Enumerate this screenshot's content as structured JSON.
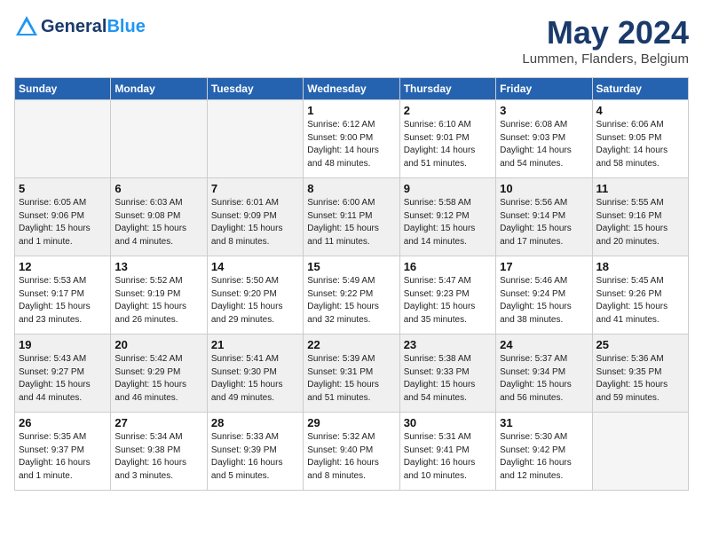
{
  "header": {
    "logo_general": "General",
    "logo_blue": "Blue",
    "month_title": "May 2024",
    "location": "Lummen, Flanders, Belgium"
  },
  "days_of_week": [
    "Sunday",
    "Monday",
    "Tuesday",
    "Wednesday",
    "Thursday",
    "Friday",
    "Saturday"
  ],
  "weeks": [
    [
      {
        "day": "",
        "info": "",
        "empty": true
      },
      {
        "day": "",
        "info": "",
        "empty": true
      },
      {
        "day": "",
        "info": "",
        "empty": true
      },
      {
        "day": "1",
        "info": "Sunrise: 6:12 AM\nSunset: 9:00 PM\nDaylight: 14 hours\nand 48 minutes."
      },
      {
        "day": "2",
        "info": "Sunrise: 6:10 AM\nSunset: 9:01 PM\nDaylight: 14 hours\nand 51 minutes."
      },
      {
        "day": "3",
        "info": "Sunrise: 6:08 AM\nSunset: 9:03 PM\nDaylight: 14 hours\nand 54 minutes."
      },
      {
        "day": "4",
        "info": "Sunrise: 6:06 AM\nSunset: 9:05 PM\nDaylight: 14 hours\nand 58 minutes."
      }
    ],
    [
      {
        "day": "5",
        "info": "Sunrise: 6:05 AM\nSunset: 9:06 PM\nDaylight: 15 hours\nand 1 minute.",
        "shaded": true
      },
      {
        "day": "6",
        "info": "Sunrise: 6:03 AM\nSunset: 9:08 PM\nDaylight: 15 hours\nand 4 minutes.",
        "shaded": true
      },
      {
        "day": "7",
        "info": "Sunrise: 6:01 AM\nSunset: 9:09 PM\nDaylight: 15 hours\nand 8 minutes.",
        "shaded": true
      },
      {
        "day": "8",
        "info": "Sunrise: 6:00 AM\nSunset: 9:11 PM\nDaylight: 15 hours\nand 11 minutes.",
        "shaded": true
      },
      {
        "day": "9",
        "info": "Sunrise: 5:58 AM\nSunset: 9:12 PM\nDaylight: 15 hours\nand 14 minutes.",
        "shaded": true
      },
      {
        "day": "10",
        "info": "Sunrise: 5:56 AM\nSunset: 9:14 PM\nDaylight: 15 hours\nand 17 minutes.",
        "shaded": true
      },
      {
        "day": "11",
        "info": "Sunrise: 5:55 AM\nSunset: 9:16 PM\nDaylight: 15 hours\nand 20 minutes.",
        "shaded": true
      }
    ],
    [
      {
        "day": "12",
        "info": "Sunrise: 5:53 AM\nSunset: 9:17 PM\nDaylight: 15 hours\nand 23 minutes."
      },
      {
        "day": "13",
        "info": "Sunrise: 5:52 AM\nSunset: 9:19 PM\nDaylight: 15 hours\nand 26 minutes."
      },
      {
        "day": "14",
        "info": "Sunrise: 5:50 AM\nSunset: 9:20 PM\nDaylight: 15 hours\nand 29 minutes."
      },
      {
        "day": "15",
        "info": "Sunrise: 5:49 AM\nSunset: 9:22 PM\nDaylight: 15 hours\nand 32 minutes."
      },
      {
        "day": "16",
        "info": "Sunrise: 5:47 AM\nSunset: 9:23 PM\nDaylight: 15 hours\nand 35 minutes."
      },
      {
        "day": "17",
        "info": "Sunrise: 5:46 AM\nSunset: 9:24 PM\nDaylight: 15 hours\nand 38 minutes."
      },
      {
        "day": "18",
        "info": "Sunrise: 5:45 AM\nSunset: 9:26 PM\nDaylight: 15 hours\nand 41 minutes."
      }
    ],
    [
      {
        "day": "19",
        "info": "Sunrise: 5:43 AM\nSunset: 9:27 PM\nDaylight: 15 hours\nand 44 minutes.",
        "shaded": true
      },
      {
        "day": "20",
        "info": "Sunrise: 5:42 AM\nSunset: 9:29 PM\nDaylight: 15 hours\nand 46 minutes.",
        "shaded": true
      },
      {
        "day": "21",
        "info": "Sunrise: 5:41 AM\nSunset: 9:30 PM\nDaylight: 15 hours\nand 49 minutes.",
        "shaded": true
      },
      {
        "day": "22",
        "info": "Sunrise: 5:39 AM\nSunset: 9:31 PM\nDaylight: 15 hours\nand 51 minutes.",
        "shaded": true
      },
      {
        "day": "23",
        "info": "Sunrise: 5:38 AM\nSunset: 9:33 PM\nDaylight: 15 hours\nand 54 minutes.",
        "shaded": true
      },
      {
        "day": "24",
        "info": "Sunrise: 5:37 AM\nSunset: 9:34 PM\nDaylight: 15 hours\nand 56 minutes.",
        "shaded": true
      },
      {
        "day": "25",
        "info": "Sunrise: 5:36 AM\nSunset: 9:35 PM\nDaylight: 15 hours\nand 59 minutes.",
        "shaded": true
      }
    ],
    [
      {
        "day": "26",
        "info": "Sunrise: 5:35 AM\nSunset: 9:37 PM\nDaylight: 16 hours\nand 1 minute."
      },
      {
        "day": "27",
        "info": "Sunrise: 5:34 AM\nSunset: 9:38 PM\nDaylight: 16 hours\nand 3 minutes."
      },
      {
        "day": "28",
        "info": "Sunrise: 5:33 AM\nSunset: 9:39 PM\nDaylight: 16 hours\nand 5 minutes."
      },
      {
        "day": "29",
        "info": "Sunrise: 5:32 AM\nSunset: 9:40 PM\nDaylight: 16 hours\nand 8 minutes."
      },
      {
        "day": "30",
        "info": "Sunrise: 5:31 AM\nSunset: 9:41 PM\nDaylight: 16 hours\nand 10 minutes."
      },
      {
        "day": "31",
        "info": "Sunrise: 5:30 AM\nSunset: 9:42 PM\nDaylight: 16 hours\nand 12 minutes."
      },
      {
        "day": "",
        "info": "",
        "empty": true
      }
    ]
  ]
}
